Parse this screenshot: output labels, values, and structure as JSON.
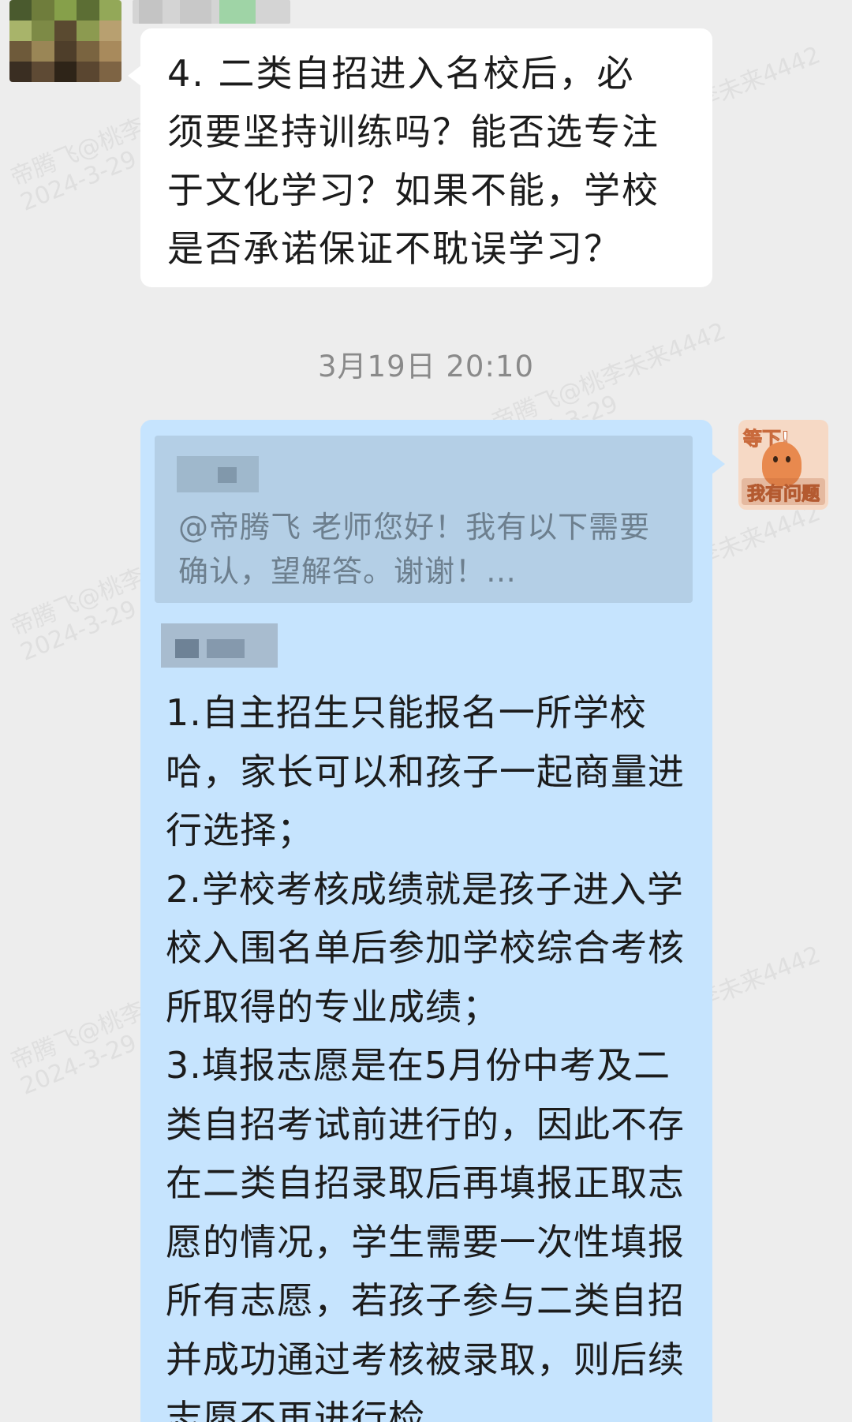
{
  "watermark": {
    "name_line": "帝腾飞@桃李未来4442",
    "date_line": "2024-3-29"
  },
  "messages": [
    {
      "direction": "incoming",
      "text": "4. 二类自招进入名校后，必须要坚持训练吗？能否选专注于文化学习？如果不能，学校是否承诺保证不耽误学习？"
    }
  ],
  "timestamp": "3月19日  20:10",
  "reply": {
    "direction": "outgoing",
    "quote_text": "@帝腾飞 老师您好！我有以下需要确认，望解答。谢谢！…",
    "text": "1.自主招生只能报名一所学校哈，家长可以和孩子一起商量进行选择；\n2.学校考核成绩就是孩子进入学校入围名单后参加学校综合考核所取得的专业成绩；\n3.填报志愿是在5月份中考及二类自招考试前进行的，因此不存在二类自招录取后再填报正取志愿的情况，学生需要一次性填报所有志愿，若孩子参与二类自招并成功通过考核被录取，则后续志愿不再进行检"
  },
  "sticker": {
    "top_text": "等下!",
    "bottom_text": "我有问题"
  },
  "colors": {
    "background": "#ededed",
    "incoming_bubble": "#ffffff",
    "outgoing_bubble": "#c6e4fe",
    "quote_box": "#b4cfe6",
    "timestamp_text": "#8a8a8a"
  }
}
